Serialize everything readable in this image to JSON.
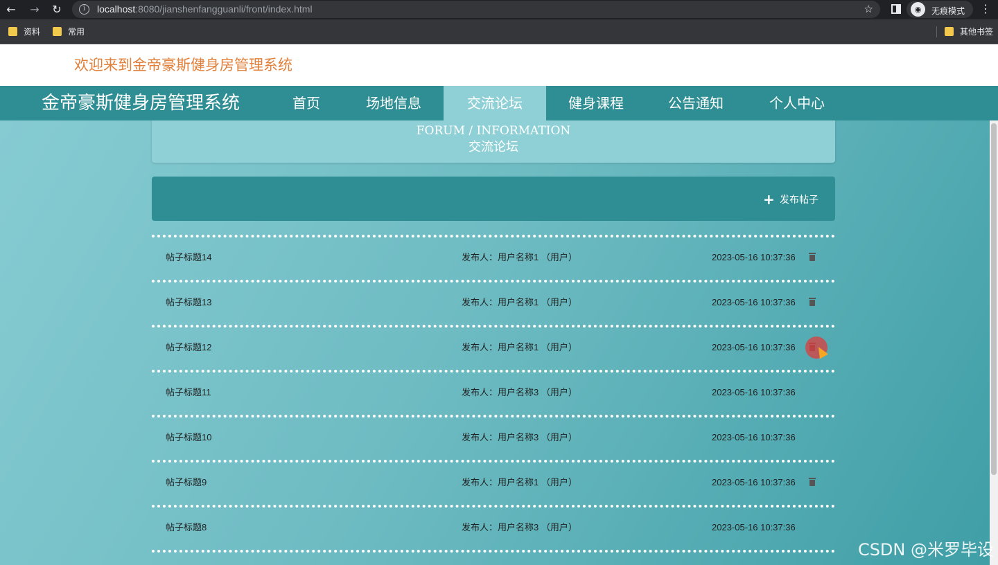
{
  "browser": {
    "url_host": "localhost",
    "url_rest": ":8080/jianshenfangguanli/front/index.html",
    "incognito_label": "无痕模式",
    "bookmarks": [
      "资料",
      "常用"
    ],
    "other_bookmarks": "其他书签"
  },
  "site": {
    "welcome": "欢迎来到金帝豪斯健身房管理系统",
    "brand": "金帝豪斯健身房管理系统",
    "nav": [
      {
        "label": "首页"
      },
      {
        "label": "场地信息"
      },
      {
        "label": "交流论坛",
        "active": true
      },
      {
        "label": "健身课程"
      },
      {
        "label": "公告通知"
      },
      {
        "label": "个人中心"
      }
    ]
  },
  "page": {
    "title_en": "FORUM / INFORMATION",
    "title_cn": "交流论坛",
    "post_button": "发布帖子"
  },
  "posts": [
    {
      "title": "帖子标题14",
      "author": "发布人：用户名称1 （用户）",
      "time": "2023-05-16 10:37:36",
      "deletable": true
    },
    {
      "title": "帖子标题13",
      "author": "发布人：用户名称1 （用户）",
      "time": "2023-05-16 10:37:36",
      "deletable": true
    },
    {
      "title": "帖子标题12",
      "author": "发布人：用户名称1 （用户）",
      "time": "2023-05-16 10:37:36",
      "deletable": true
    },
    {
      "title": "帖子标题11",
      "author": "发布人：用户名称3 （用户）",
      "time": "2023-05-16 10:37:36",
      "deletable": false
    },
    {
      "title": "帖子标题10",
      "author": "发布人：用户名称3 （用户）",
      "time": "2023-05-16 10:37:36",
      "deletable": false
    },
    {
      "title": "帖子标题9",
      "author": "发布人：用户名称1 （用户）",
      "time": "2023-05-16 10:37:36",
      "deletable": true
    },
    {
      "title": "帖子标题8",
      "author": "发布人：用户名称3 （用户）",
      "time": "2023-05-16 10:37:36",
      "deletable": false
    }
  ],
  "watermark": "CSDN @米罗毕设",
  "icons": {
    "back": "back-arrow-icon",
    "forward": "forward-arrow-icon",
    "reload": "reload-icon",
    "info": "info-icon",
    "star": "star-icon",
    "trash": "trash-icon",
    "plus": "plus-icon"
  },
  "colors": {
    "nav_bg": "#2f8e93",
    "nav_active": "#8fd0d6",
    "welcome": "#e0803a"
  }
}
